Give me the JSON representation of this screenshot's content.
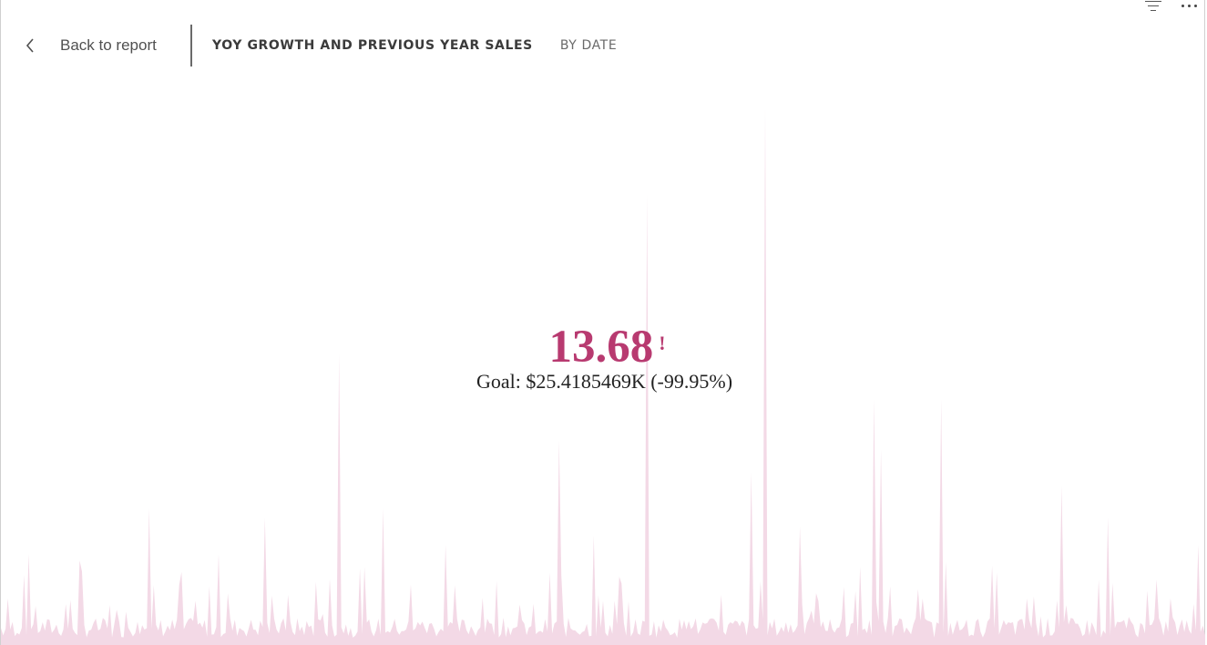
{
  "header": {
    "back_label": "Back to report",
    "title": "YOY GROWTH AND PREVIOUS YEAR SALES",
    "subtitle": "BY DATE"
  },
  "toolbar": {
    "icons": [
      "filter-icon",
      "more-options-icon"
    ]
  },
  "kpi": {
    "value": "13.68",
    "alert_symbol": "!",
    "goal_text": "Goal: $25.4185469K (-99.95%)"
  },
  "colors": {
    "kpi_value": "#b83a70",
    "trend_fill": "#f3d9e6",
    "text_dark": "#3b3b3b",
    "text_muted": "#6a6a6a"
  }
}
